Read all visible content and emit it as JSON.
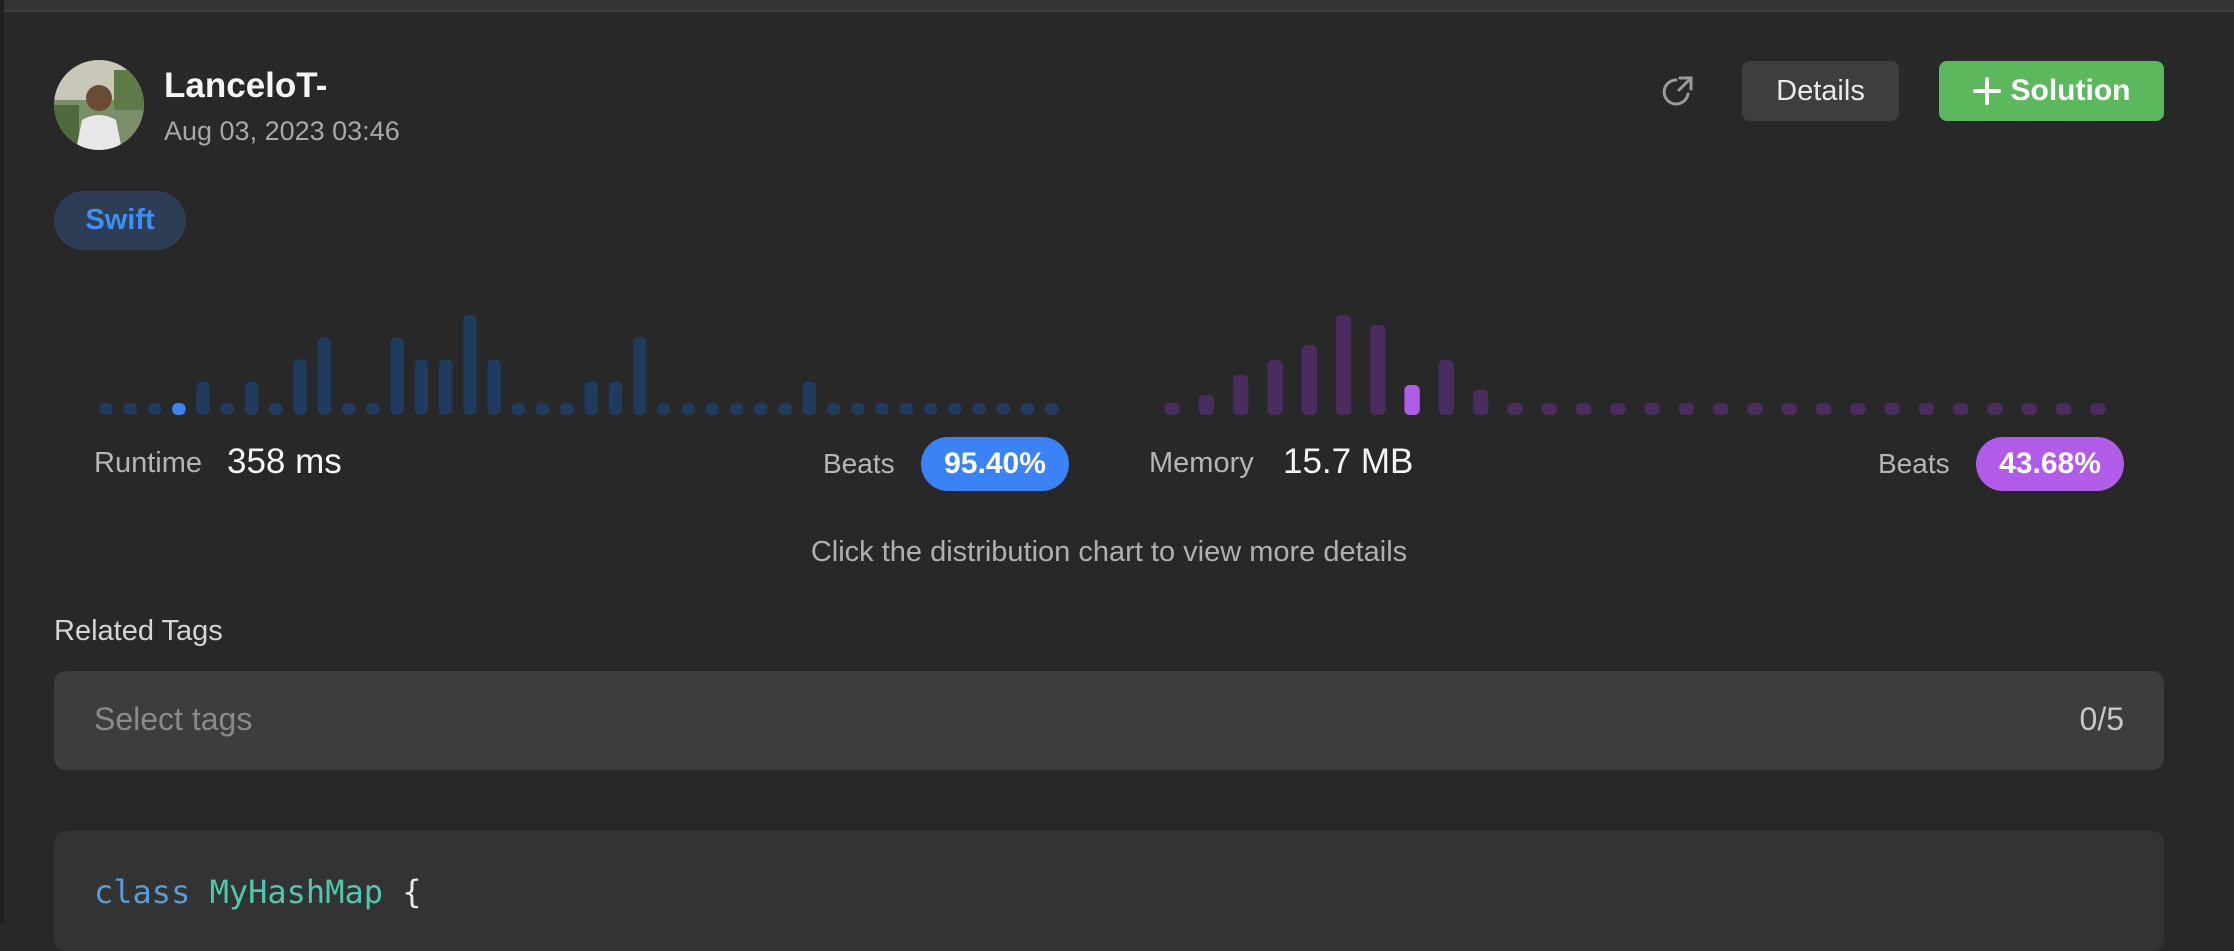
{
  "user": {
    "name": "LanceloT-",
    "date": "Aug 03, 2023 03:46"
  },
  "toolbar": {
    "share_icon": "share-icon",
    "details_label": "Details",
    "solution_label": "Solution"
  },
  "language": "Swift",
  "runtime": {
    "label": "Runtime",
    "value": "358 ms",
    "beats_label": "Beats",
    "beats": "95.40%",
    "color": "#3b82f6"
  },
  "memory": {
    "label": "Memory",
    "value": "15.7 MB",
    "beats_label": "Beats",
    "beats": "43.68%",
    "color": "#b15ce9"
  },
  "hint": "Click the distribution chart to view more details",
  "tags": {
    "title": "Related Tags",
    "placeholder": "Select tags",
    "count": "0/5"
  },
  "code": {
    "keyword": "class",
    "type": "MyHashMap",
    "brace": "{"
  },
  "chart_data": [
    {
      "type": "bar",
      "title": "Runtime distribution",
      "values": [
        1,
        1,
        1,
        1,
        3,
        1,
        3,
        1,
        5,
        7,
        1,
        1,
        7,
        5,
        5,
        9,
        5,
        1,
        1,
        1,
        3,
        3,
        7,
        1,
        1,
        1,
        1,
        1,
        1,
        3,
        1,
        1,
        1,
        1,
        1,
        1,
        1,
        1,
        1,
        1
      ],
      "highlight_index": 3,
      "base_color": "#1f3b5e",
      "highlight_color": "#3b82f6"
    },
    {
      "type": "bar",
      "title": "Memory distribution",
      "values": [
        1,
        2,
        4,
        5.5,
        7,
        10,
        9,
        3,
        5.5,
        2.5,
        0.5,
        0.5,
        0.5,
        0.5,
        0.5,
        1,
        1,
        0.5,
        0.5,
        0.5,
        0.5,
        0.5,
        1,
        1,
        1,
        0.5,
        0.5,
        0.5
      ],
      "highlight_index": 7,
      "base_color": "#4a2d5e",
      "highlight_color": "#b15ce9"
    }
  ]
}
